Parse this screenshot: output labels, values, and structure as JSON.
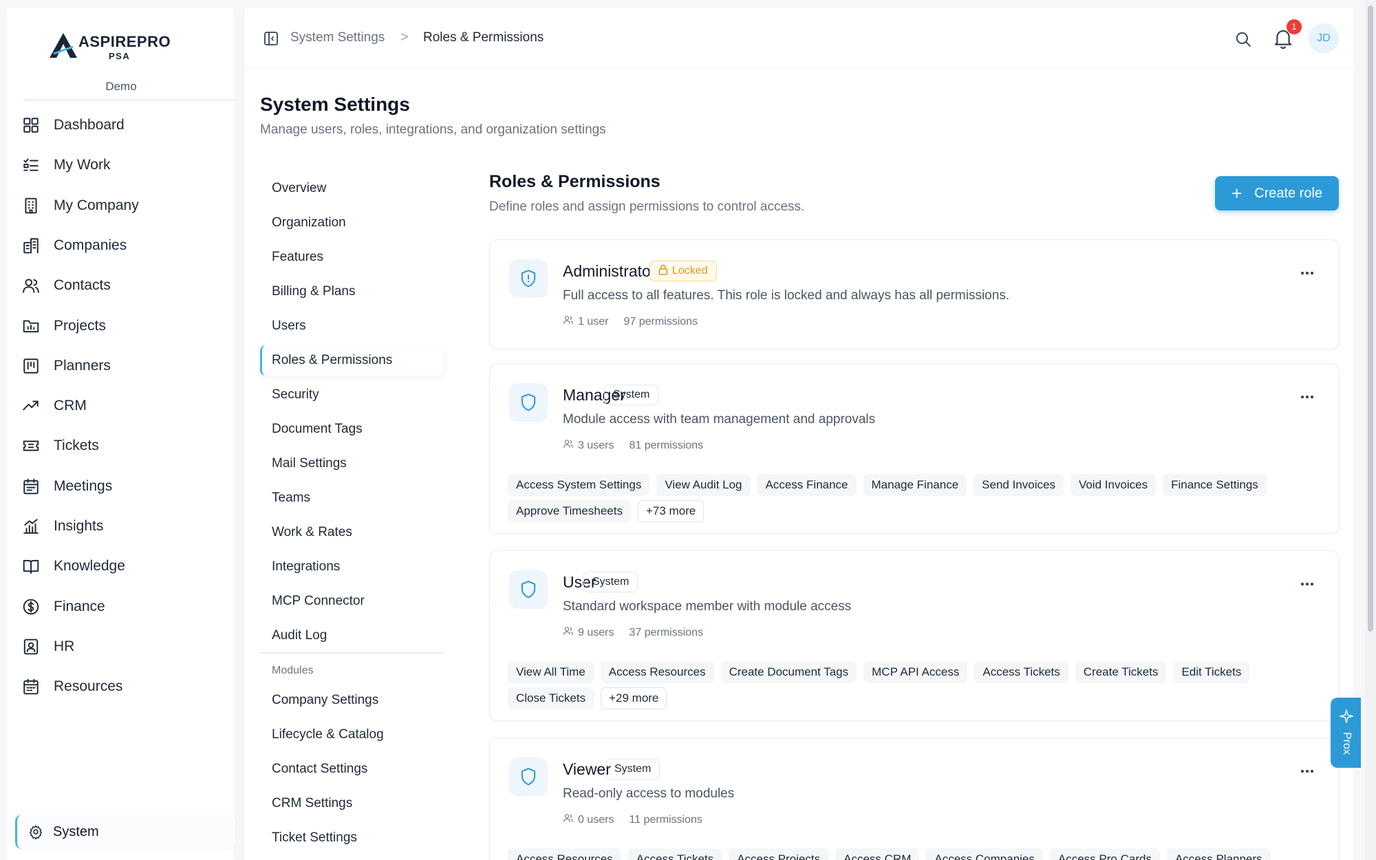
{
  "brand": {
    "name": "ASPIREPRO",
    "sub": "PSA",
    "workspace": "Demo"
  },
  "sidebar": {
    "items": [
      {
        "label": "Dashboard",
        "icon": "dashboard-grid-icon"
      },
      {
        "label": "My Work",
        "icon": "task-list-icon"
      },
      {
        "label": "My Company",
        "icon": "building-icon"
      },
      {
        "label": "Companies",
        "icon": "buildings-icon"
      },
      {
        "label": "Contacts",
        "icon": "users-icon"
      },
      {
        "label": "Projects",
        "icon": "folder-chart-icon"
      },
      {
        "label": "Planners",
        "icon": "kanban-icon"
      },
      {
        "label": "CRM",
        "icon": "trending-up-icon"
      },
      {
        "label": "Tickets",
        "icon": "ticket-icon"
      },
      {
        "label": "Meetings",
        "icon": "calendar-icon"
      },
      {
        "label": "Insights",
        "icon": "bar-chart-icon"
      },
      {
        "label": "Knowledge",
        "icon": "book-icon"
      },
      {
        "label": "Finance",
        "icon": "dollar-circle-icon"
      },
      {
        "label": "HR",
        "icon": "id-badge-icon"
      },
      {
        "label": "Resources",
        "icon": "calendar-grid-icon"
      }
    ],
    "system_label": "System"
  },
  "breadcrumb": {
    "parent": "System Settings",
    "separator": ">",
    "current": "Roles & Permissions"
  },
  "notifications": {
    "count": "1"
  },
  "user": {
    "initials": "JD"
  },
  "page": {
    "title": "System Settings",
    "subtitle": "Manage users, roles, integrations, and organization settings"
  },
  "settings_nav": {
    "items": [
      "Overview",
      "Organization",
      "Features",
      "Billing & Plans",
      "Users",
      "Roles & Permissions",
      "Security",
      "Document Tags",
      "Mail Settings",
      "Teams",
      "Work & Rates",
      "Integrations",
      "MCP Connector",
      "Audit Log"
    ],
    "active": "Roles & Permissions",
    "modules_heading": "Modules",
    "modules": [
      "Company Settings",
      "Lifecycle & Catalog",
      "Contact Settings",
      "CRM Settings",
      "Ticket Settings"
    ]
  },
  "roles_section": {
    "title": "Roles & Permissions",
    "subtitle": "Define roles and assign permissions to control access.",
    "create_label": "Create role"
  },
  "roles": [
    {
      "name": "Administrator",
      "badge": "Locked",
      "description": "Full access to all features. This role is locked and always has all permissions.",
      "users": "1 user",
      "permissions": "97 permissions",
      "tags": [],
      "more": ""
    },
    {
      "name": "Manager",
      "badge": "System",
      "description": "Module access with team management and approvals",
      "users": "3 users",
      "permissions": "81 permissions",
      "tags": [
        "Access System Settings",
        "View Audit Log",
        "Access Finance",
        "Manage Finance",
        "Send Invoices",
        "Void Invoices",
        "Finance Settings",
        "Approve Timesheets"
      ],
      "more": "+73 more"
    },
    {
      "name": "User",
      "badge": "System",
      "description": "Standard workspace member with module access",
      "users": "9 users",
      "permissions": "37 permissions",
      "tags": [
        "View All Time",
        "Access Resources",
        "Create Document Tags",
        "MCP API Access",
        "Access Tickets",
        "Create Tickets",
        "Edit Tickets",
        "Close Tickets"
      ],
      "more": "+29 more"
    },
    {
      "name": "Viewer",
      "badge": "System",
      "description": "Read-only access to modules",
      "users": "0 users",
      "permissions": "11 permissions",
      "tags": [
        "Access Resources",
        "Access Tickets",
        "Access Projects",
        "Access CRM",
        "Access Companies",
        "Access Pro Cards",
        "Access Planners"
      ],
      "more": ""
    }
  ],
  "assistant": {
    "label": "Prox"
  },
  "colors": {
    "accent": "#2d9ad8",
    "active_border": "#45b3e6",
    "badge_red": "#ef3b36",
    "locked": "#d99a1a"
  }
}
